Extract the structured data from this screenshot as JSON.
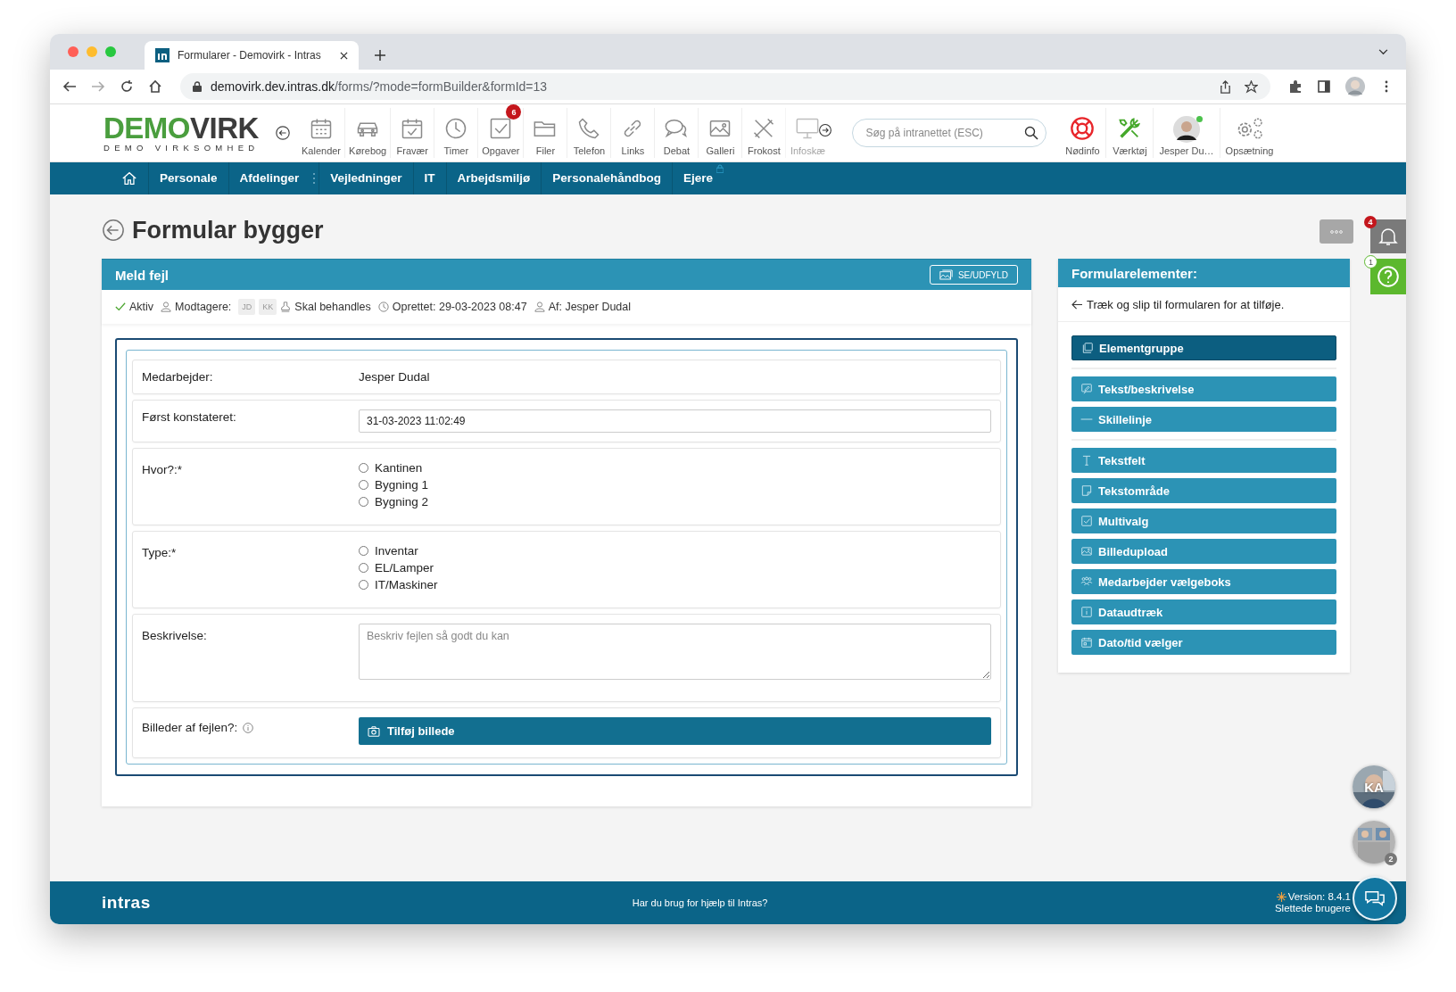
{
  "browser": {
    "tab_title": "Formularer - Demovirk - Intras",
    "url_host": "demovirk.dev.intras.dk",
    "url_path": "/forms/?mode=formBuilder&formId=13"
  },
  "header": {
    "logo": {
      "first": "DEMO",
      "second": "VIRK",
      "subtitle": "DEMO VIRKSOMHED"
    },
    "apps": [
      {
        "label": "Kalender"
      },
      {
        "label": "Kørebog"
      },
      {
        "label": "Fravær"
      },
      {
        "label": "Timer"
      },
      {
        "label": "Opgaver",
        "badge": "6"
      },
      {
        "label": "Filer"
      },
      {
        "label": "Telefon"
      },
      {
        "label": "Links"
      },
      {
        "label": "Debat"
      },
      {
        "label": "Galleri"
      },
      {
        "label": "Frokost"
      },
      {
        "label": "Infoskæ"
      }
    ],
    "search_placeholder": "Søg på intranettet (ESC)",
    "tools": [
      {
        "label": "Nødinfo"
      },
      {
        "label": "Værktøj"
      }
    ],
    "user": {
      "name": "Jesper Du…",
      "online": true
    },
    "settings_label": "Opsætning"
  },
  "nav": {
    "items": [
      {
        "label": "Personale",
        "locked": false
      },
      {
        "label": "Afdelinger",
        "locked": false
      },
      {
        "label": "Vejledninger",
        "locked": false
      },
      {
        "label": "IT",
        "locked": false
      },
      {
        "label": "Arbejdsmiljø",
        "locked": false
      },
      {
        "label": "Personalehåndbog",
        "locked": false
      },
      {
        "label": "Ejere",
        "locked": true
      }
    ]
  },
  "page": {
    "title": "Formular bygger",
    "notifications_badge": "4",
    "help_badge": "1"
  },
  "form": {
    "title": "Meld fejl",
    "view_button": "SE/UDFYLD",
    "meta": {
      "status": "Aktiv",
      "recipients_label": "Modtagere:",
      "recipients": [
        "JD",
        "KK"
      ],
      "handling": "Skal behandles",
      "created": "Oprettet: 29-03-2023 08:47",
      "author": "Af: Jesper Dudal"
    },
    "fields": [
      {
        "kind": "static",
        "label": "Medarbejder:",
        "value": "Jesper Dudal"
      },
      {
        "kind": "input",
        "label": "Først konstateret:",
        "value": "31-03-2023 11:02:49"
      },
      {
        "kind": "radio",
        "label": "Hvor?:*",
        "options": [
          {
            "label": "Kantinen",
            "selected": false
          },
          {
            "label": "Bygning 1",
            "selected": false
          },
          {
            "label": "Bygning 2",
            "selected": false
          }
        ]
      },
      {
        "kind": "radio",
        "label": "Type:*",
        "options": [
          {
            "label": "Inventar",
            "selected": false
          },
          {
            "label": "EL/Lamper",
            "selected": false
          },
          {
            "label": "IT/Maskiner",
            "selected": false
          }
        ]
      },
      {
        "kind": "textarea",
        "label": "Beskrivelse:",
        "placeholder": "Beskriv fejlen så godt du kan"
      },
      {
        "kind": "upload",
        "label": "Billeder af fejlen?:",
        "info": true,
        "button": "Tilføj billede"
      }
    ]
  },
  "panel": {
    "title": "Formularelementer:",
    "hint": "Træk og slip til formularen for at tilføje.",
    "groups": [
      [
        {
          "label": "Elementgruppe",
          "kind": "group"
        }
      ],
      [
        {
          "label": "Tekst/beskrivelse",
          "kind": "element"
        },
        {
          "label": "Skillelinje",
          "kind": "element"
        }
      ],
      [
        {
          "label": "Tekstfelt",
          "kind": "element"
        },
        {
          "label": "Tekstområde",
          "kind": "element"
        },
        {
          "label": "Multivalg",
          "kind": "element"
        },
        {
          "label": "Billedupload",
          "kind": "element"
        },
        {
          "label": "Medarbejder vælgeboks",
          "kind": "element"
        },
        {
          "label": "Dataudtræk",
          "kind": "element"
        },
        {
          "label": "Dato/tid vælger",
          "kind": "element"
        }
      ]
    ]
  },
  "chat": {
    "avatars": [
      {
        "initials": "KA"
      },
      {
        "count": "2"
      }
    ]
  },
  "footer": {
    "brand": "intras",
    "help": "Har du brug for hjælp til Intras?",
    "version": "Version: 8.4.1",
    "deleted_users": "Slettede brugere"
  }
}
